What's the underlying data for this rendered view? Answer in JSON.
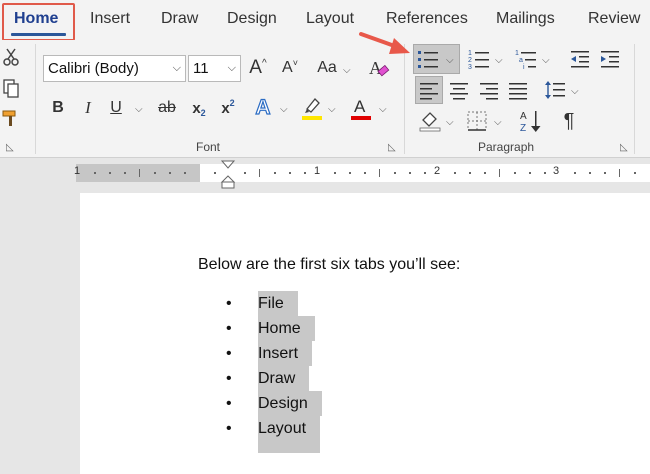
{
  "tabs": [
    {
      "label": "Home",
      "active": true
    },
    {
      "label": "Insert"
    },
    {
      "label": "Draw"
    },
    {
      "label": "Design"
    },
    {
      "label": "Layout"
    },
    {
      "label": "References"
    },
    {
      "label": "Mailings"
    },
    {
      "label": "Review"
    }
  ],
  "font_group": {
    "font_name": "Calibri (Body)",
    "font_size": "11",
    "grow_font": "A",
    "shrink_font": "A",
    "change_case": "Aa",
    "bold": "B",
    "italic": "I",
    "underline": "U",
    "strikethrough": "ab",
    "subscript": "x",
    "superscript": "x",
    "text_effects": "A",
    "font_color": "A",
    "label": "Font"
  },
  "paragraph_group": {
    "label": "Paragraph",
    "pilcrow": "¶"
  },
  "ruler": {
    "numbers": [
      "1",
      "1",
      "2",
      "3"
    ]
  },
  "document": {
    "intro": "Below are the first six tabs you’ll see:",
    "bullets": [
      "File",
      "Home",
      "Insert",
      "Draw",
      "Design",
      "Layout"
    ]
  },
  "colors": {
    "accent": "#2b579a",
    "highlight_box": "#e05a4a",
    "arrow": "#e8584a",
    "text_highlight": "#ffe600",
    "font_color": "#e00000",
    "selection": "#c8c8c8"
  }
}
